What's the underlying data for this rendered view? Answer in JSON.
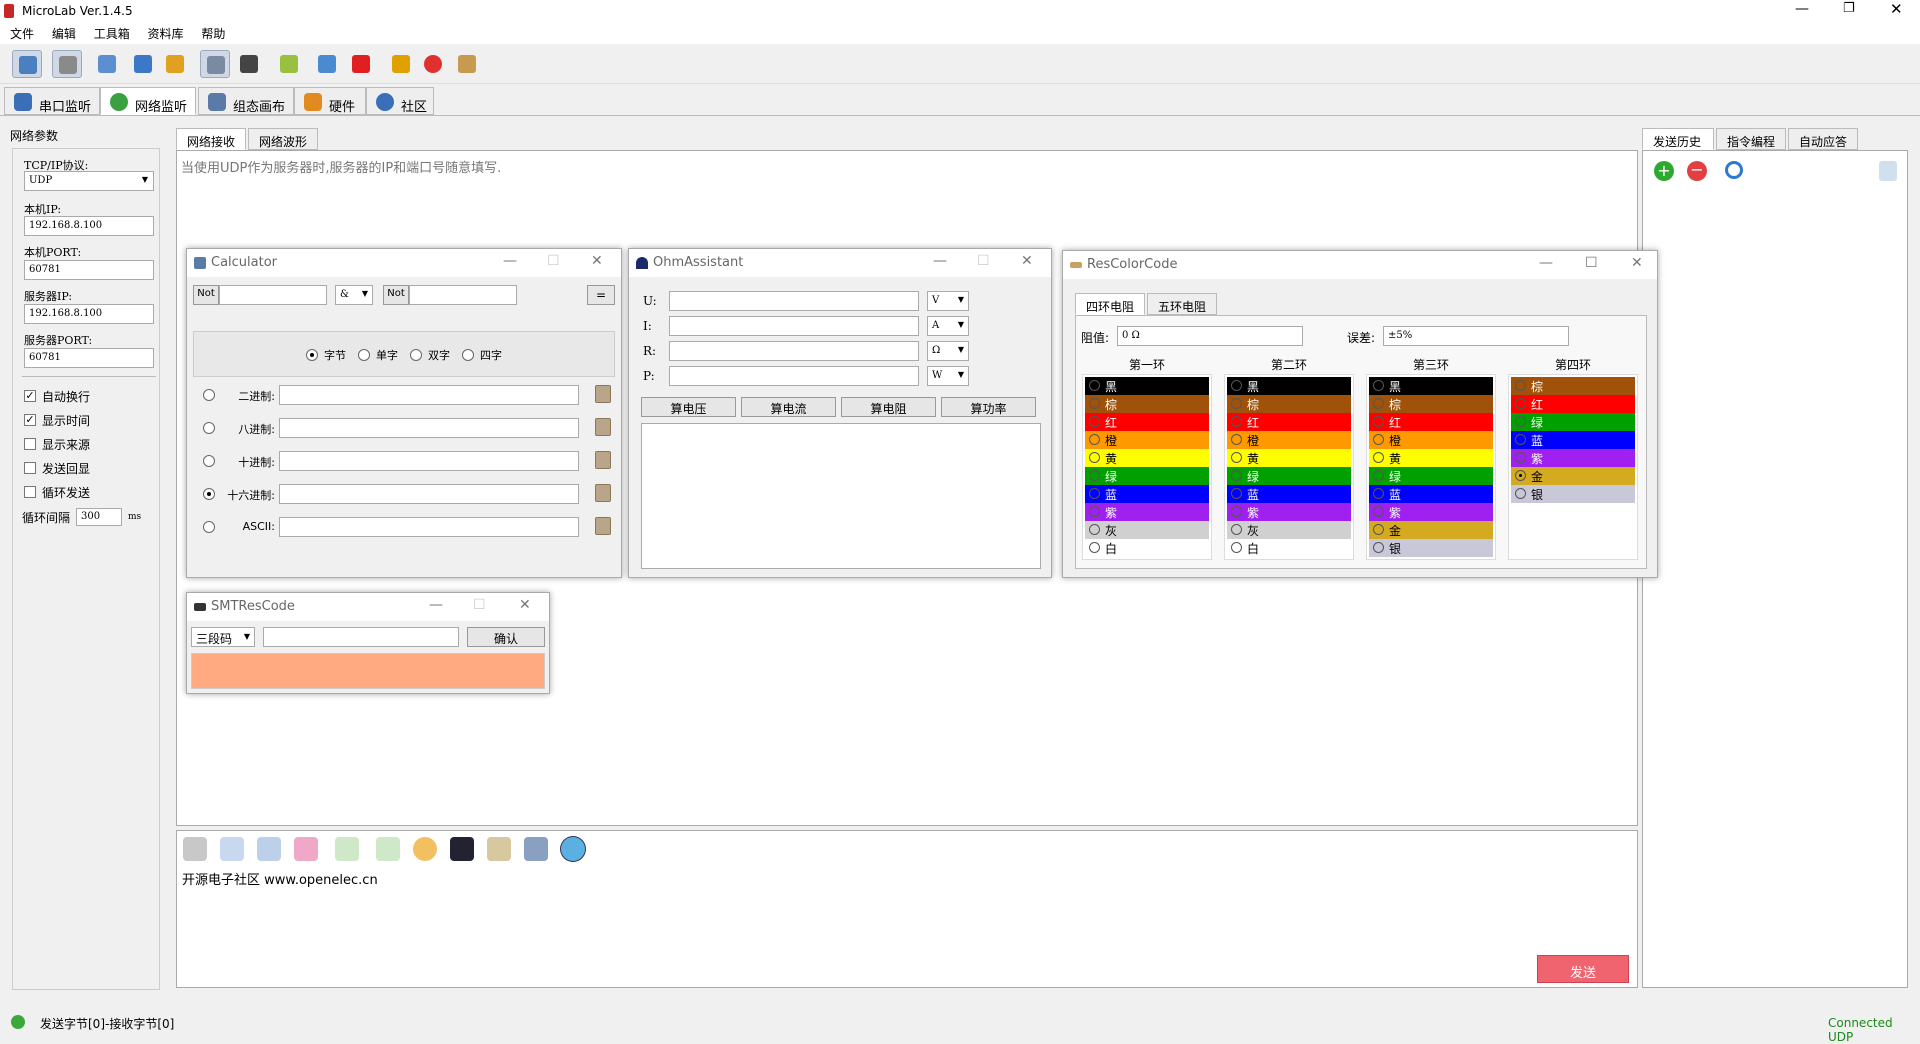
{
  "app": {
    "title": "MicroLab Ver.1.4.5",
    "status_text": "发送字节[0]-接收字节[0]",
    "connection_status": "Connected UDP"
  },
  "menu": [
    "文件",
    "编辑",
    "工具箱",
    "资料库",
    "帮助"
  ],
  "main_tabs": [
    "串口监听",
    "网络监听",
    "组态画布",
    "硬件",
    "社区"
  ],
  "params": {
    "title": "网络参数",
    "protocol_label": "TCP/IP协议:",
    "protocol_value": "UDP",
    "local_ip_label": "本机IP:",
    "local_ip": "192.168.8.100",
    "local_port_label": "本机PORT:",
    "local_port": "60781",
    "server_ip_label": "服务器IP:",
    "server_ip": "192.168.8.100",
    "server_port_label": "服务器PORT:",
    "server_port": "60781",
    "options": [
      {
        "label": "自动换行",
        "checked": true
      },
      {
        "label": "显示时间",
        "checked": true
      },
      {
        "label": "显示来源",
        "checked": false
      },
      {
        "label": "发送回显",
        "checked": false
      },
      {
        "label": "循环发送",
        "checked": false
      }
    ],
    "interval_label": "循环间隔",
    "interval_value": "300",
    "interval_unit": "ms"
  },
  "center": {
    "tab_receive": "网络接收",
    "tab_wave": "网络波形",
    "hint": "当使用UDP作为服务器时,服务器的IP和端口号随意填写.",
    "send_text": "开源电子社区 www.openelec.cn",
    "send_button": "发送"
  },
  "right_tabs": [
    "发送历史",
    "指令编程",
    "自动应答"
  ],
  "calculator": {
    "title": "Calculator",
    "not1": "Not",
    "op": "&",
    "not2": "Not",
    "eq": "=",
    "word_sizes": [
      "字节",
      "单字",
      "双字",
      "四字"
    ],
    "bases": [
      "二进制:",
      "八进制:",
      "十进制:",
      "十六进制:",
      "ASCII:"
    ]
  },
  "ohm": {
    "title": "OhmAssistant",
    "rows": [
      {
        "label": "U:",
        "unit": "V"
      },
      {
        "label": "I:",
        "unit": "A"
      },
      {
        "label": "R:",
        "unit": "Ω"
      },
      {
        "label": "P:",
        "unit": "W"
      }
    ],
    "buttons": [
      "算电压",
      "算电流",
      "算电阻",
      "算功率"
    ]
  },
  "rescolor": {
    "title": "ResColorCode",
    "tab4": "四环电阻",
    "tab5": "五环电阻",
    "resistance_label": "阻值:",
    "resistance_value": "0 Ω",
    "tolerance_label": "误差:",
    "tolerance_value": "±5%",
    "columns": [
      {
        "title": "第一环",
        "bands": [
          [
            "黑",
            "#000000"
          ],
          [
            "棕",
            "#a0520a"
          ],
          [
            "红",
            "#ff0000"
          ],
          [
            "橙",
            "#ff9900"
          ],
          [
            "黄",
            "#ffff00"
          ],
          [
            "绿",
            "#00a000"
          ],
          [
            "蓝",
            "#0000ff"
          ],
          [
            "紫",
            "#a020f0"
          ],
          [
            "灰",
            "#d0d0d0"
          ],
          [
            "白",
            "#ffffff"
          ]
        ]
      },
      {
        "title": "第二环",
        "bands": [
          [
            "黑",
            "#000000"
          ],
          [
            "棕",
            "#a0520a"
          ],
          [
            "红",
            "#ff0000"
          ],
          [
            "橙",
            "#ff9900"
          ],
          [
            "黄",
            "#ffff00"
          ],
          [
            "绿",
            "#00a000"
          ],
          [
            "蓝",
            "#0000ff"
          ],
          [
            "紫",
            "#a020f0"
          ],
          [
            "灰",
            "#d0d0d0"
          ],
          [
            "白",
            "#ffffff"
          ]
        ]
      },
      {
        "title": "第三环",
        "bands": [
          [
            "黑",
            "#000000"
          ],
          [
            "棕",
            "#a0520a"
          ],
          [
            "红",
            "#ff0000"
          ],
          [
            "橙",
            "#ff9900"
          ],
          [
            "黄",
            "#ffff00"
          ],
          [
            "绿",
            "#00a000"
          ],
          [
            "蓝",
            "#0000ff"
          ],
          [
            "紫",
            "#a020f0"
          ],
          [
            "金",
            "#d4aa20"
          ],
          [
            "银",
            "#c8c8d8"
          ]
        ]
      },
      {
        "title": "第四环",
        "bands": [
          [
            "棕",
            "#a0520a"
          ],
          [
            "红",
            "#ff0000"
          ],
          [
            "绿",
            "#00a000"
          ],
          [
            "蓝",
            "#0000ff"
          ],
          [
            "紫",
            "#a020f0"
          ],
          [
            "金",
            "#d4aa20"
          ],
          [
            "银",
            "#c8c8d8"
          ]
        ]
      }
    ]
  },
  "smt": {
    "title": "SMTResCode",
    "mode": "三段码",
    "confirm": "确认",
    "color": "#ffaa80"
  }
}
